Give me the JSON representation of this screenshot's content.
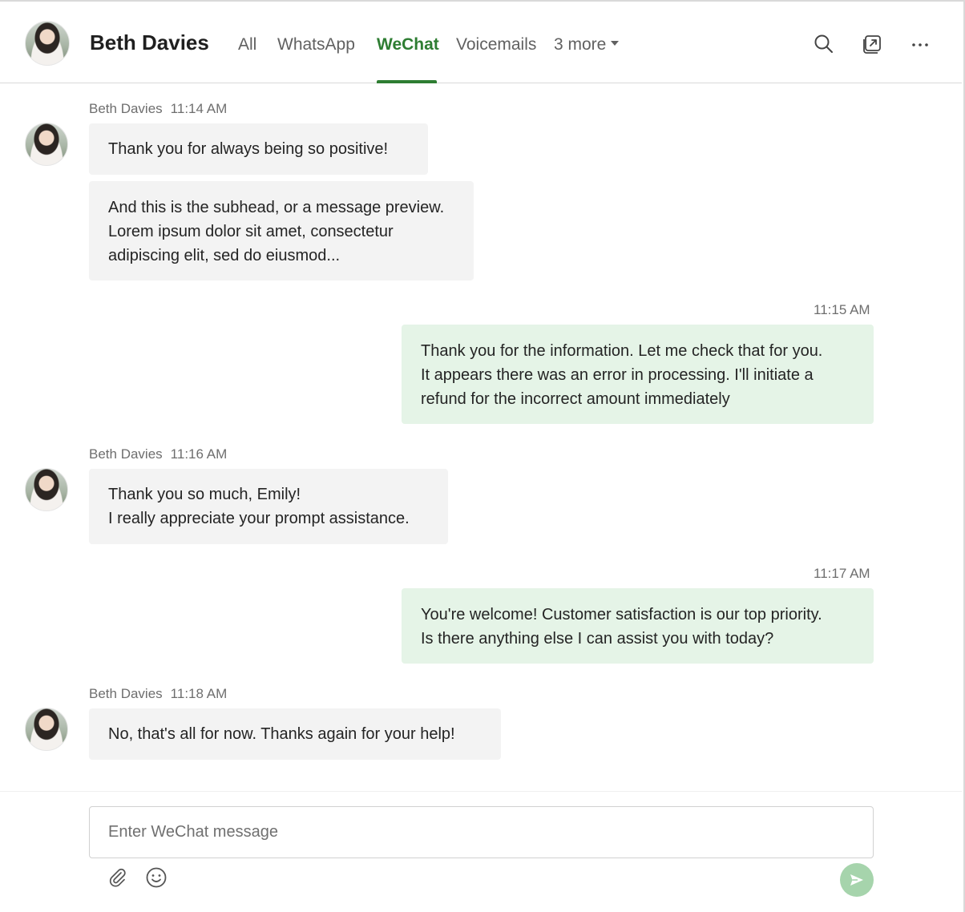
{
  "header": {
    "contact_name": "Beth Davies",
    "tabs": [
      {
        "label": "All"
      },
      {
        "label": "WhatsApp"
      },
      {
        "label": "WeChat",
        "active": true
      },
      {
        "label": "Voicemails"
      },
      {
        "label": "3 more"
      }
    ],
    "icons": [
      "search-icon",
      "popout-icon",
      "more-options-icon"
    ]
  },
  "messages": [
    {
      "direction": "in",
      "sender": "Beth Davies",
      "time": "11:14 AM",
      "texts": [
        "Thank you for always being so positive!",
        "And this is the subhead, or a message preview.\nLorem ipsum dolor sit amet, consectetur\nadipiscing elit, sed do eiusmod..."
      ]
    },
    {
      "direction": "out",
      "time": "11:15 AM",
      "texts": [
        "Thank you for the information. Let me check that for you.\nIt appears there was an error in processing. I'll initiate a\nrefund for the incorrect amount immediately"
      ]
    },
    {
      "direction": "in",
      "sender": "Beth Davies",
      "time": "11:16 AM",
      "texts": [
        "Thank you so much, Emily!\nI really appreciate your prompt assistance."
      ]
    },
    {
      "direction": "out",
      "time": "11:17 AM",
      "texts": [
        "You're welcome! Customer satisfaction is our top priority.\nIs there anything else I can assist you with today?"
      ]
    },
    {
      "direction": "in",
      "sender": "Beth Davies",
      "time": "11:18 AM",
      "texts": [
        "No, that's all for now. Thanks again for your help!"
      ]
    }
  ],
  "composer": {
    "placeholder": "Enter WeChat message",
    "value": ""
  },
  "colors": {
    "accent": "#2e7d32",
    "incoming_bubble": "#f3f3f3",
    "outgoing_bubble": "#e5f4e7",
    "send_button": "#a6d4ac"
  }
}
